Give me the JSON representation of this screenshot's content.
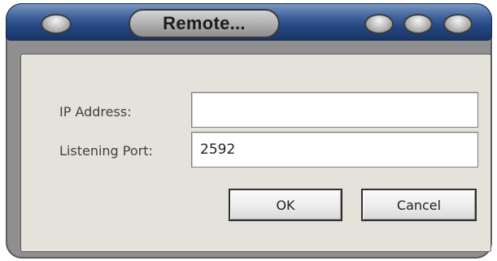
{
  "window": {
    "title": "Remote...",
    "icons": {
      "menu": "system-menu-icon",
      "buttons": [
        "minimize-icon",
        "maximize-icon",
        "close-icon"
      ]
    },
    "colors": {
      "titlebar": "#23457f",
      "client_bg": "#e4e2da"
    }
  },
  "form": {
    "ip_label": "IP Address:",
    "ip_value": "",
    "port_label": "Listening Port:",
    "port_value": "2592"
  },
  "buttons": {
    "ok": "OK",
    "cancel": "Cancel"
  }
}
